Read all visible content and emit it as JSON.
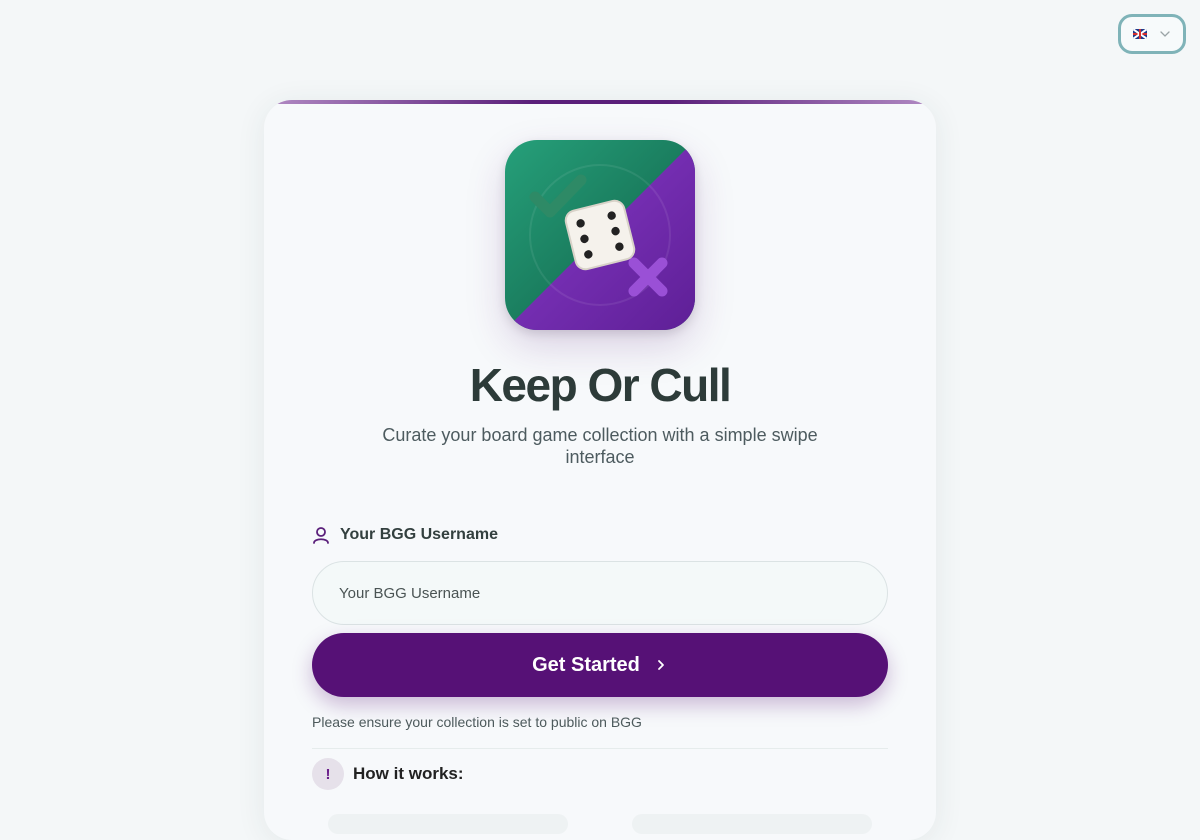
{
  "language": {
    "selected": "English",
    "flag": "uk-flag"
  },
  "app": {
    "title": "Keep Or Cull",
    "subtitle": "Curate your board game collection with a simple swipe interface"
  },
  "form": {
    "label": "Your BGG Username",
    "placeholder": "Your BGG Username",
    "value": "",
    "submit": "Get Started",
    "note": "Please ensure your collection is set to public on BGG"
  },
  "how": {
    "badge": "!",
    "title": "How it works:"
  },
  "colors": {
    "primary": "#561176",
    "logo_green": "#1f7a5c",
    "logo_purple": "#7a2fb0",
    "lang_border": "#7fb3b8"
  }
}
